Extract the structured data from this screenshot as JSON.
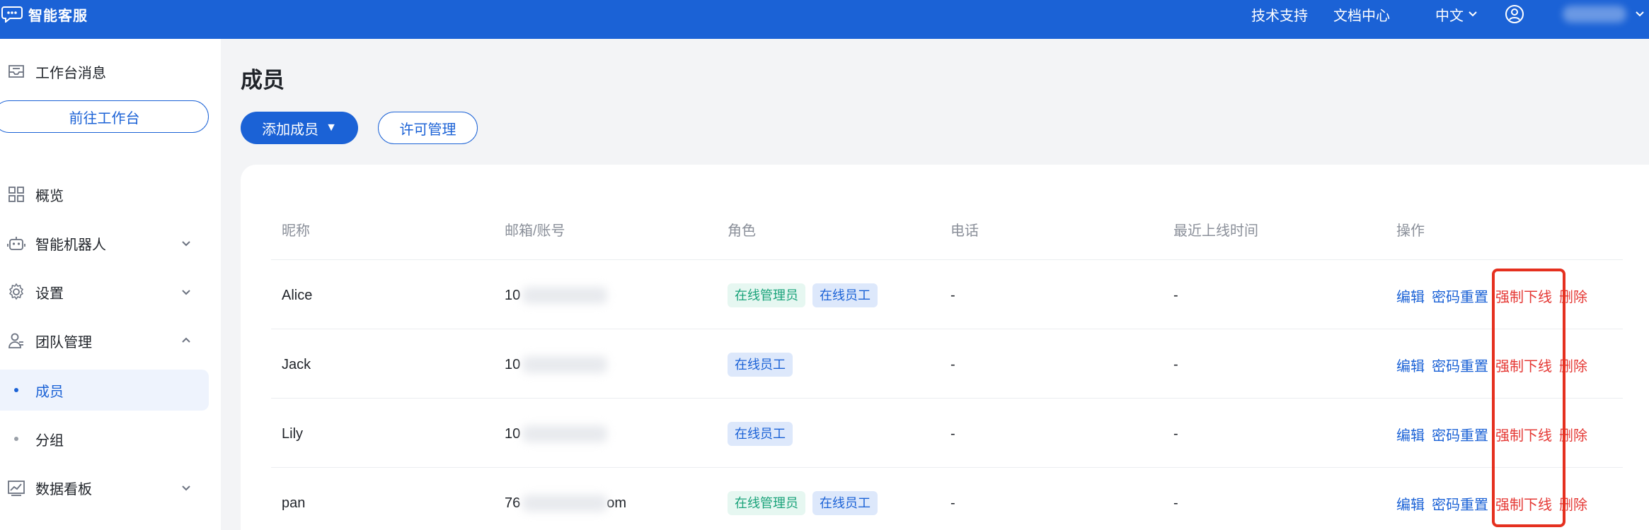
{
  "topbar": {
    "brand": "智能客服",
    "support": "技术支持",
    "docs": "文档中心",
    "language": "中文",
    "colors": {
      "bar": "#1b62d6"
    }
  },
  "sidebar": {
    "workbench_messages": "工作台消息",
    "goto_workbench": "前往工作台",
    "items": [
      {
        "label": "概览",
        "icon": "grid-icon"
      },
      {
        "label": "智能机器人",
        "icon": "robot-icon",
        "expanded": false
      },
      {
        "label": "设置",
        "icon": "gear-icon",
        "expanded": false
      },
      {
        "label": "团队管理",
        "icon": "team-icon",
        "expanded": true
      },
      {
        "label": "数据看板",
        "icon": "chart-icon",
        "expanded": false
      }
    ],
    "team_sub": [
      {
        "label": "成员",
        "active": true
      },
      {
        "label": "分组",
        "active": false
      }
    ]
  },
  "main": {
    "title": "成员",
    "add_member": "添加成员",
    "license": "许可管理",
    "columns": [
      "昵称",
      "邮箱/账号",
      "角色",
      "电话",
      "最近上线时间",
      "操作"
    ],
    "rows": [
      {
        "nickname": "Alice",
        "email_prefix": "10",
        "email_suffix": "",
        "roles": [
          "在线管理员",
          "在线员工"
        ],
        "phone": "-",
        "last_online": "-"
      },
      {
        "nickname": "Jack",
        "email_prefix": "10",
        "email_suffix": "",
        "roles": [
          "在线员工"
        ],
        "phone": "-",
        "last_online": "-"
      },
      {
        "nickname": "Lily",
        "email_prefix": "10",
        "email_suffix": "",
        "roles": [
          "在线员工"
        ],
        "phone": "-",
        "last_online": "-"
      },
      {
        "nickname": "pan",
        "email_prefix": "76",
        "email_suffix": "om",
        "roles": [
          "在线管理员",
          "在线员工"
        ],
        "phone": "-",
        "last_online": "-"
      }
    ],
    "actions": {
      "edit": "编辑",
      "reset_password": "密码重置",
      "force_offline": "强制下线",
      "delete": "删除"
    },
    "role_colors": {
      "在线管理员": "#1aa37a",
      "在线员工": "#1b62d6"
    }
  }
}
